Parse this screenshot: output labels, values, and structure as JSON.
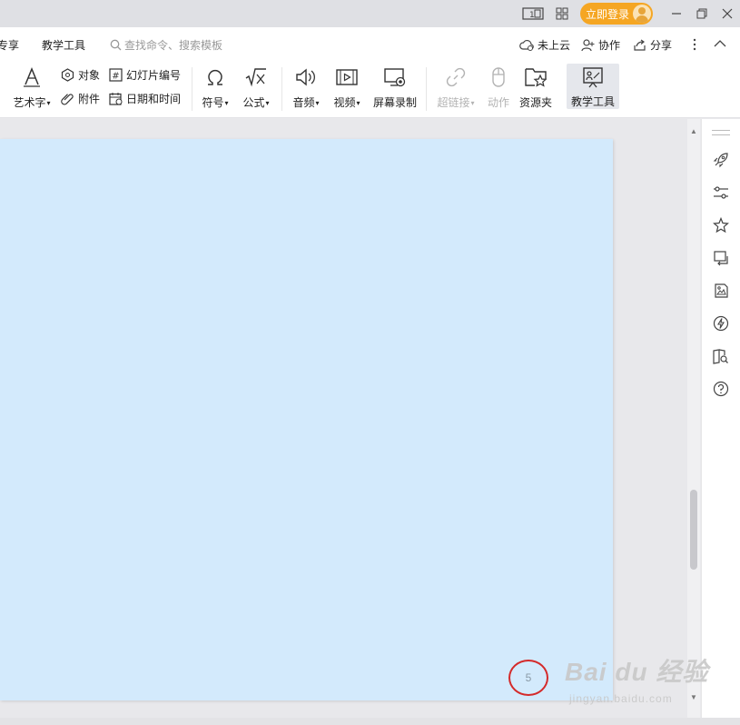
{
  "titlebar": {
    "icons": [
      "page-layout-icon",
      "apps-grid-icon",
      "minimize-icon",
      "restore-icon",
      "close-icon"
    ],
    "login_label": "立即登录"
  },
  "menu": {
    "tabs": [
      "专享",
      "教学工具"
    ],
    "search_placeholder": "查找命令、搜索模板",
    "right_items": [
      "未上云",
      "协作",
      "分享"
    ]
  },
  "ribbon": {
    "wordart": "艺术字",
    "object": "对象",
    "attachment": "附件",
    "slide_number": "幻灯片编号",
    "datetime": "日期和时间",
    "symbol": "符号",
    "formula": "公式",
    "audio": "音频",
    "video": "视频",
    "screen_record": "屏幕录制",
    "hyperlink": "超链接",
    "action": "动作",
    "resources": "资源夹",
    "teach_tool": "教学工具"
  },
  "slide": {
    "page_number": "5",
    "background_color": "#d3eafc"
  },
  "watermark": {
    "main": "Bai du 经验",
    "sub": "jingyan.baidu.com"
  },
  "right_panel": {
    "icons": [
      "rocket-icon",
      "sliders-icon",
      "star-icon",
      "swap-icon",
      "image-edit-icon",
      "lightning-icon",
      "book-search-icon",
      "help-icon"
    ]
  },
  "colors": {
    "accent": "#f5a623",
    "highlight_circle": "#d42a2a"
  }
}
